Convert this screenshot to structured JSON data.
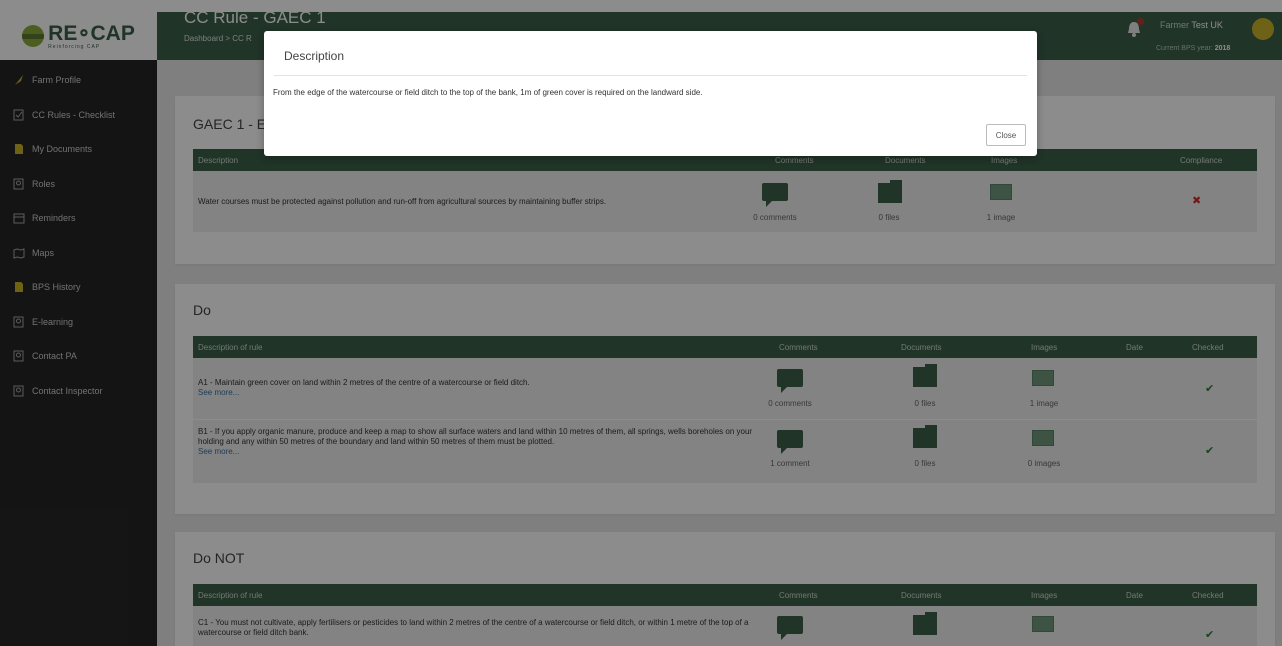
{
  "header": {
    "logo_text": "RE∘CAP",
    "logo_subtext": "Reinforcing CAP",
    "page_title": "CC Rule - GAEC 1",
    "breadcrumb": "Dashboard > CC R",
    "user_prefix": "Farmer ",
    "user_name": "Test UK",
    "bps_label": "Current BPS year: ",
    "bps_year": "2018",
    "notification_count": "1"
  },
  "sidebar": {
    "items": [
      {
        "label": "Farm Profile",
        "icon": "feather-icon"
      },
      {
        "label": "CC Rules - Checklist",
        "icon": "checklist-icon"
      },
      {
        "label": "My Documents",
        "icon": "document-icon"
      },
      {
        "label": "Roles",
        "icon": "roles-icon"
      },
      {
        "label": "Reminders",
        "icon": "calendar-icon"
      },
      {
        "label": "Maps",
        "icon": "map-icon"
      },
      {
        "label": "BPS History",
        "icon": "document-icon"
      },
      {
        "label": "E-learning",
        "icon": "e-learning-icon"
      },
      {
        "label": "Contact PA",
        "icon": "contact-icon"
      },
      {
        "label": "Contact Inspector",
        "icon": "contact-icon"
      }
    ]
  },
  "gaec": {
    "title": "GAEC 1 - E",
    "headers": {
      "description": "Description",
      "comments": "Comments",
      "documents": "Documents",
      "images": "Images",
      "compliance": "Compliance"
    },
    "row": {
      "description": "Water courses must be protected against pollution and run-off from agricultural sources by maintaining buffer strips.",
      "comments": "0 comments",
      "files": "0 files",
      "images": "1 image",
      "compliance": "✖"
    }
  },
  "do": {
    "title": "Do",
    "headers": {
      "description": "Description of rule",
      "comments": "Comments",
      "documents": "Documents",
      "images": "Images",
      "date": "Date",
      "checked": "Checked"
    },
    "rows": [
      {
        "description": "A1 - Maintain green cover on land within 2 metres of the centre of a watercourse or field ditch.",
        "more": "See more...",
        "comments": "0 comments",
        "files": "0 files",
        "images": "1 image",
        "checked": "✔"
      },
      {
        "description": "B1 - If you apply organic manure, produce and keep a map to show all surface waters and land within 10 metres of them, all springs, wells boreholes on your holding and any within 50 metres of the boundary and land within 50 metres of them must be plotted.",
        "more": "See more...",
        "comments": "1 comment",
        "files": "0 files",
        "images": "0 images",
        "checked": "✔"
      }
    ]
  },
  "do_not": {
    "title": "Do NOT",
    "headers": {
      "description": "Description of rule",
      "comments": "Comments",
      "documents": "Documents",
      "images": "Images",
      "date": "Date",
      "checked": "Checked"
    },
    "rows": [
      {
        "description": "C1 - You must not cultivate, apply fertilisers or pesticides to land within 2 metres of the centre of a watercourse or field ditch, or within 1 metre of the top of a watercourse or field ditch bank.",
        "checked": "✔"
      }
    ]
  },
  "modal": {
    "title": "Description",
    "body": "From the edge of the watercourse or field ditch to the top of the bank, 1m of green cover is required on the landward side.",
    "close_label": "Close"
  }
}
